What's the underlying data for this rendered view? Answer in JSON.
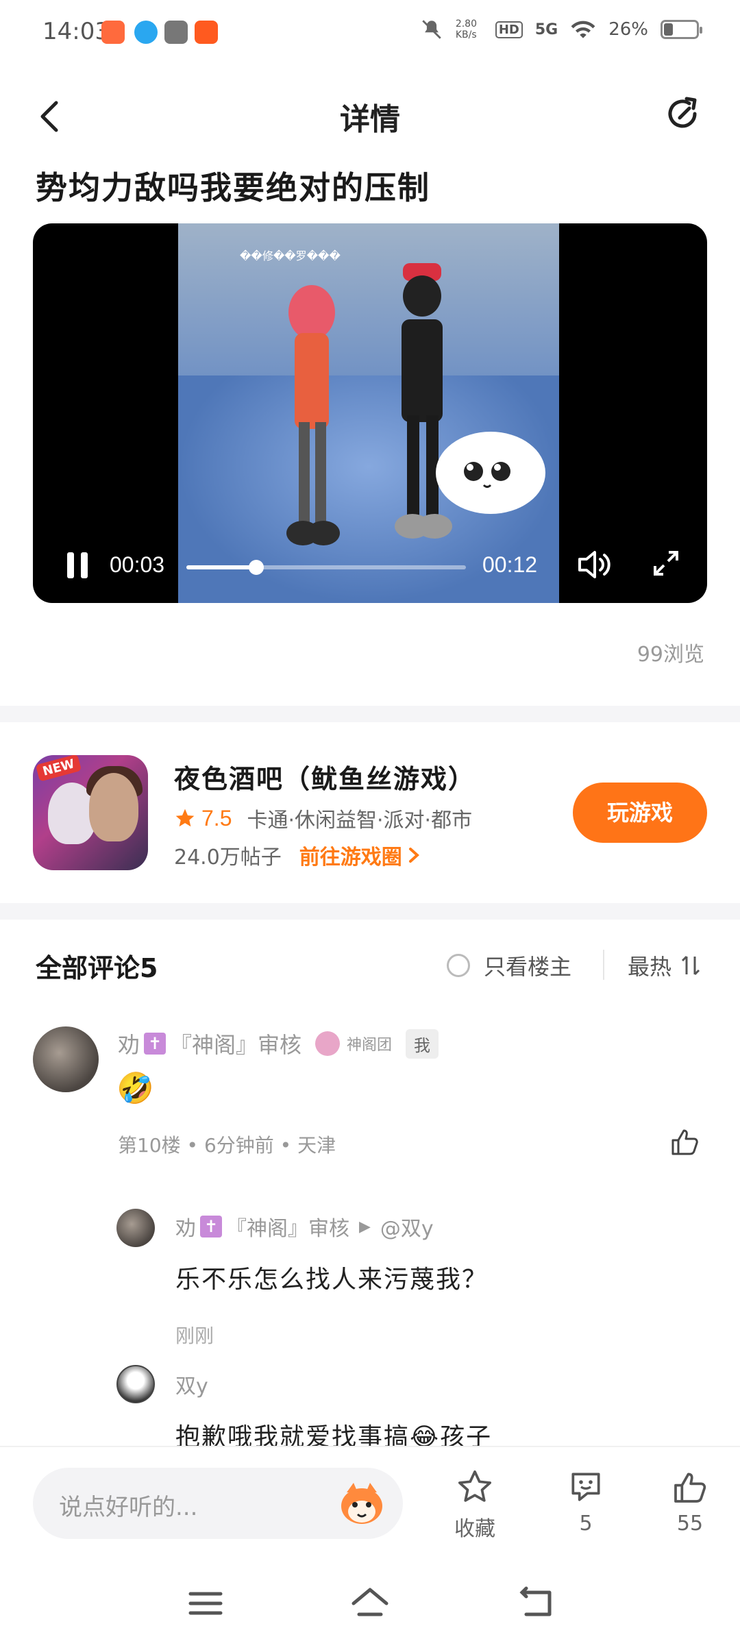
{
  "status": {
    "time": "14:03",
    "net_speed": "2.80 KB/s",
    "hd": "HD",
    "signal": "5G",
    "battery": "26%"
  },
  "header": {
    "title": "详情"
  },
  "post": {
    "title": "势均力敌吗我要绝对的压制",
    "views": "99浏览"
  },
  "video": {
    "overlay_name": "��修��罗���",
    "current_time": "00:03",
    "total_time": "00:12",
    "progress_fraction": 0.25
  },
  "game": {
    "badge": "NEW",
    "title": "夜色酒吧（鱿鱼丝游戏）",
    "rating": "7.5",
    "tags": "卡通·休闲益智·派对·都市",
    "post_count": "24.0万帖子",
    "goto_label": "前往游戏圈",
    "play_label": "玩游戏"
  },
  "comments": {
    "title": "全部评论5",
    "only_op_label": "只看楼主",
    "sort_label": "最热",
    "main": {
      "user_prefix": "劝",
      "cross": "✝",
      "user_suffix": "『神阁』审核",
      "group": "神阁团",
      "me_tag": "我",
      "emoji": "🤣",
      "meta": "第10楼 • 6分钟前 • 天津"
    },
    "replies": [
      {
        "user_prefix": "劝",
        "cross": "✝",
        "user_suffix": "『神阁』审核",
        "reply_to": "@双y",
        "text": "乐不乐怎么找人来污蔑我？",
        "time": "刚刚"
      },
      {
        "user": "双y",
        "text": "抱歉哦我就爱找事搞😂孩子"
      }
    ]
  },
  "bottom": {
    "input_placeholder": "说点好听的...",
    "favorite_label": "收藏",
    "comment_count": "5",
    "like_count": "55"
  }
}
